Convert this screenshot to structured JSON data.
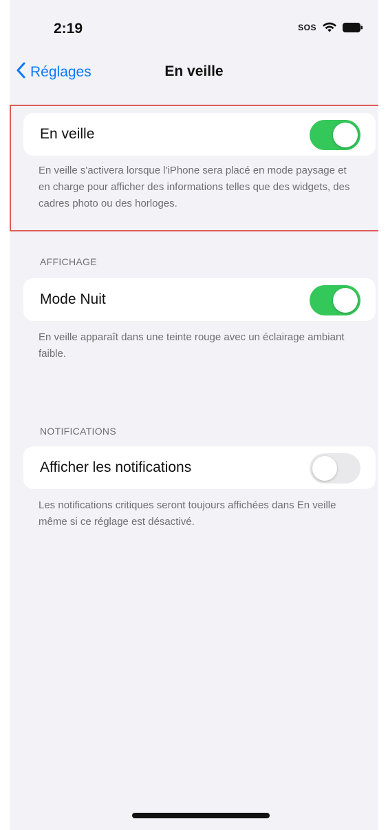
{
  "status_bar": {
    "time": "2:19",
    "sos": "SOS",
    "wifi_icon": "wifi-icon",
    "battery_icon": "battery-icon"
  },
  "nav": {
    "back_label": "Réglages",
    "back_icon": "chevron-left-icon",
    "title": "En veille"
  },
  "standby": {
    "label": "En veille",
    "enabled": true,
    "footer": "En veille s'activera lorsque l'iPhone sera placé en mode paysage et en charge pour afficher des informations telles que des widgets, des cadres photo ou des horloges."
  },
  "display_section": {
    "header": "AFFICHAGE",
    "night_mode_label": "Mode Nuit",
    "night_mode_enabled": true,
    "footer": "En veille apparaît dans une teinte rouge avec un éclairage ambiant faible."
  },
  "notifications_section": {
    "header": "NOTIFICATIONS",
    "show_notifications_label": "Afficher les notifications",
    "show_notifications_enabled": false,
    "footer": "Les notifications critiques seront toujours affichées dans En veille même si ce réglage est désactivé."
  },
  "colors": {
    "accent": "#0a7aff",
    "toggle_on": "#34c759",
    "toggle_off": "#e9e9eb",
    "highlight": "#e05a5a",
    "background": "#f2f2f7"
  }
}
